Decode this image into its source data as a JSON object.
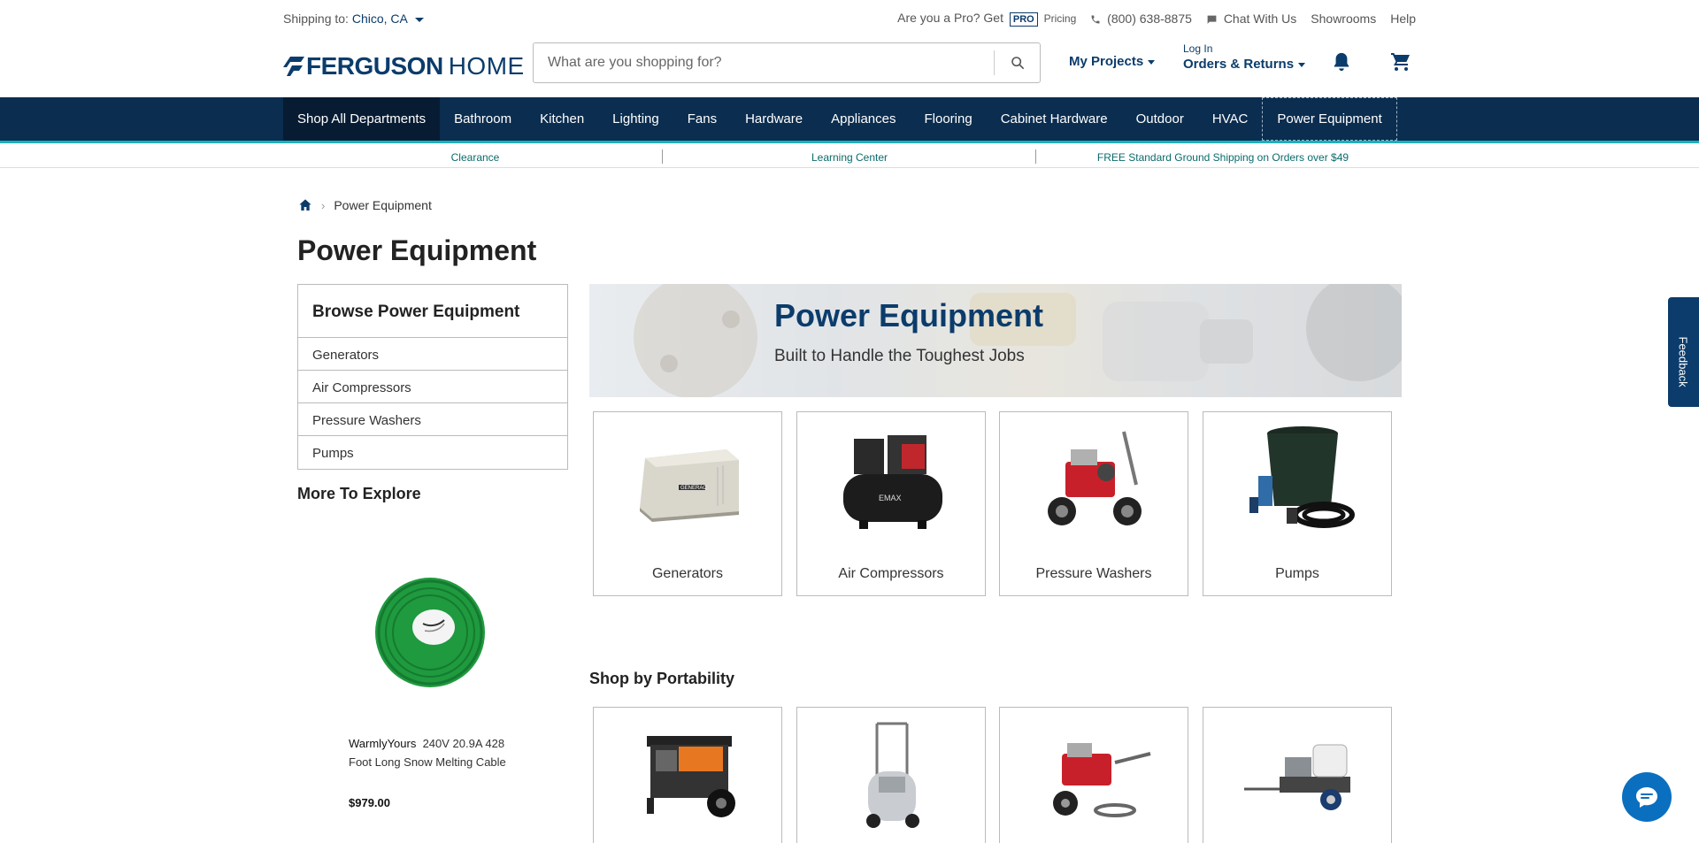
{
  "util": {
    "ship_label": "Shipping to:",
    "ship_city": "Chico, CA",
    "pro_q": "Are you a Pro? Get",
    "pro_badge": "PRO",
    "pro_pricing": "Pricing",
    "phone": "(800) 638-8875",
    "chat": "Chat With Us",
    "showrooms": "Showrooms",
    "help": "Help"
  },
  "header": {
    "brand": "FERGUSON",
    "brand_sub": "HOME",
    "search_placeholder": "What are you shopping for?",
    "my_projects": "My Projects",
    "login": "Log In",
    "orders": "Orders & Returns"
  },
  "nav": [
    "Shop All Departments",
    "Bathroom",
    "Kitchen",
    "Lighting",
    "Fans",
    "Hardware",
    "Appliances",
    "Flooring",
    "Cabinet Hardware",
    "Outdoor",
    "HVAC",
    "Power Equipment"
  ],
  "promo": [
    "Clearance",
    "Learning Center",
    "FREE Standard Ground Shipping on Orders over $49"
  ],
  "breadcrumb": {
    "current": "Power Equipment"
  },
  "page_title": "Power Equipment",
  "browse": {
    "title": "Browse Power Equipment",
    "items": [
      "Generators",
      "Air Compressors",
      "Pressure Washers",
      "Pumps"
    ]
  },
  "explore": {
    "title": "More To Explore",
    "product": {
      "brand": "WarmlyYours",
      "name": "240V 20.9A 428 Foot Long Snow Melting Cable",
      "price": "$979.00"
    }
  },
  "hero": {
    "title": "Power Equipment",
    "subtitle": "Built to Handle the Toughest Jobs"
  },
  "categories": [
    "Generators",
    "Air Compressors",
    "Pressure Washers",
    "Pumps"
  ],
  "portability_title": "Shop by Portability",
  "feedback": "Feedback",
  "colors": {
    "navy": "#0b2d4f",
    "accent": "#1eb0bc",
    "brand": "#0b3c6b"
  }
}
